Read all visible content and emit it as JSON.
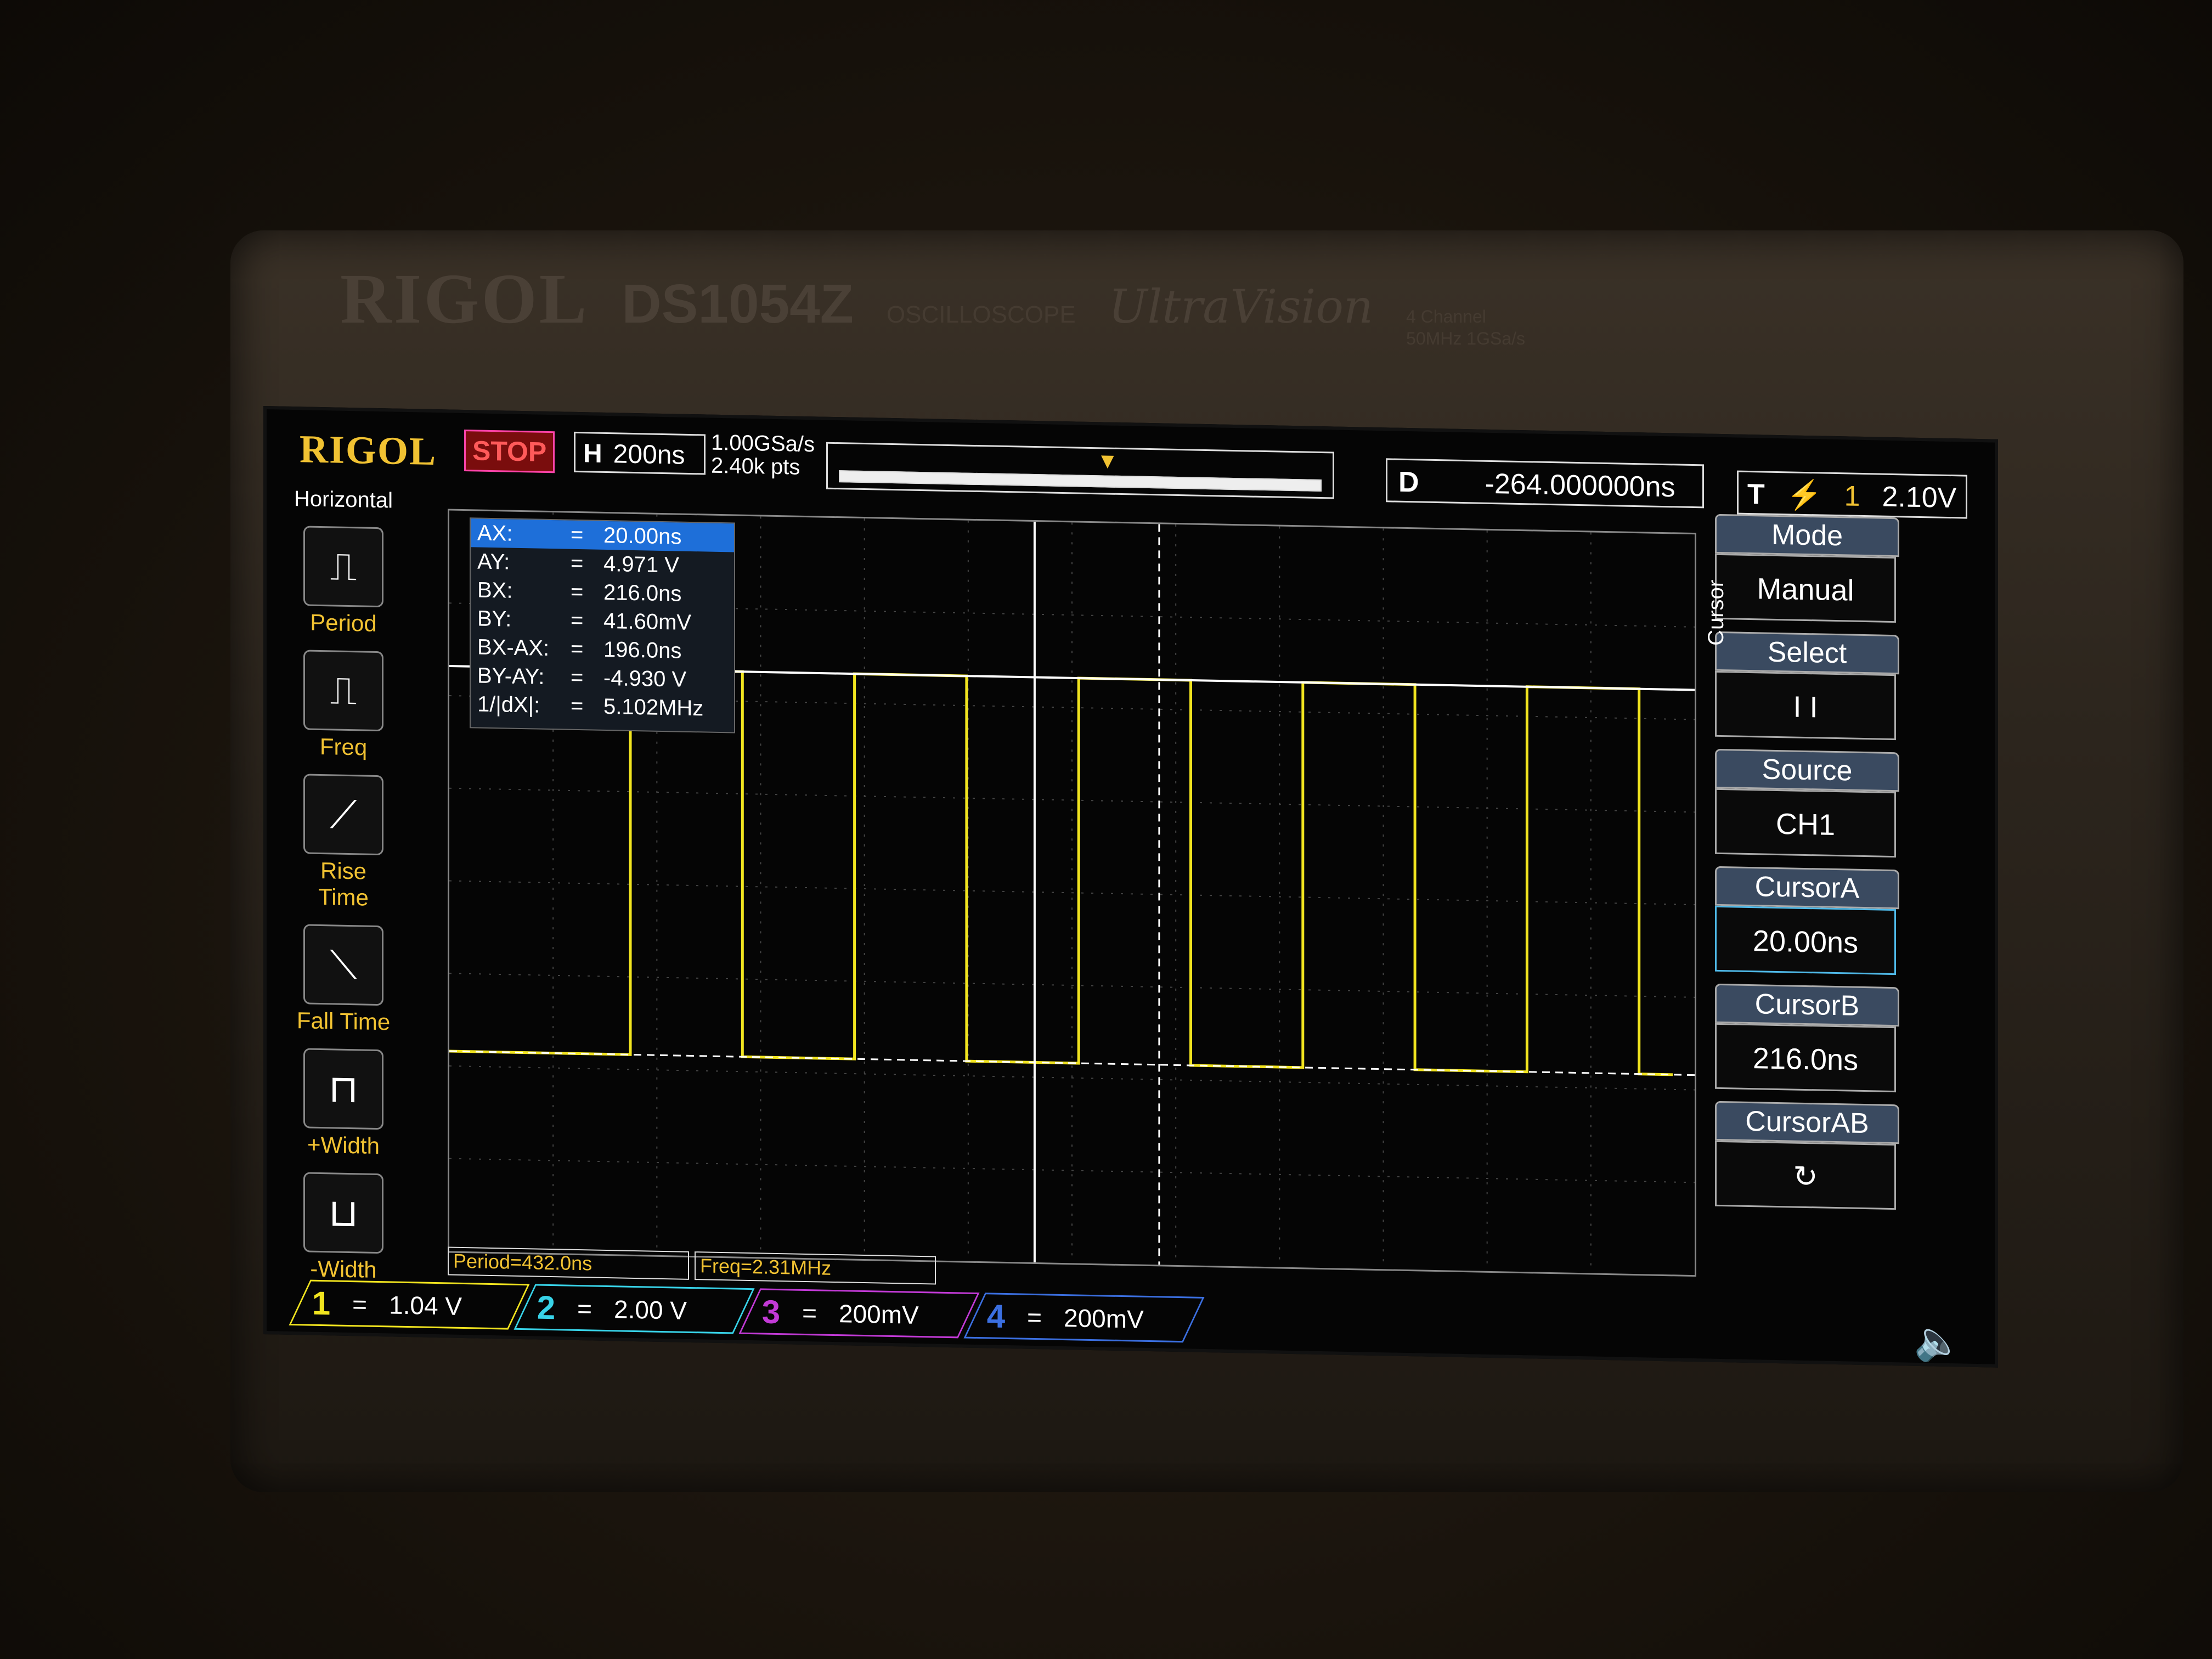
{
  "device": {
    "brand": "RIGOL",
    "model": "DS1054Z",
    "subtitle": "OSCILLOSCOPE",
    "series": "UltraVision",
    "spec_line1": "4 Channel",
    "spec_line2": "50MHz  1GSa/s"
  },
  "header": {
    "logo": "RIGOL",
    "run_state": "STOP",
    "timebase_label": "H",
    "timebase_value": "200ns",
    "sample_rate": "1.00GSa/s",
    "memory_points": "2.40k pts",
    "delay_label": "D",
    "delay_value": "-264.000000ns",
    "trigger_label": "T",
    "trigger_channel": "1",
    "trigger_level": "2.10V"
  },
  "left_menu": {
    "title": "Horizontal",
    "items": [
      {
        "label": "Period",
        "icon": "period-icon"
      },
      {
        "label": "Freq",
        "icon": "freq-icon"
      },
      {
        "label": "Rise Time",
        "icon": "rise-time-icon"
      },
      {
        "label": "Fall Time",
        "icon": "fall-time-icon"
      },
      {
        "label": "+Width",
        "icon": "pos-width-icon"
      },
      {
        "label": "-Width",
        "icon": "neg-width-icon"
      }
    ]
  },
  "cursor_readout": [
    {
      "key": "AX:",
      "value": "20.00ns"
    },
    {
      "key": "AY:",
      "value": "4.971 V"
    },
    {
      "key": "BX:",
      "value": "216.0ns"
    },
    {
      "key": "BY:",
      "value": "41.60mV"
    },
    {
      "key": "BX-AX:",
      "value": "196.0ns"
    },
    {
      "key": "BY-AY:",
      "value": "-4.930 V"
    },
    {
      "key": "1/|dX|:",
      "value": "5.102MHz"
    }
  ],
  "right_menu": {
    "side_label": "Cursor",
    "mode_title": "Mode",
    "mode_value": "Manual",
    "select_title": "Select",
    "select_value": "I  I",
    "source_title": "Source",
    "source_value": "CH1",
    "cursor_a_title": "CursorA",
    "cursor_a_value": "20.00ns",
    "cursor_b_title": "CursorB",
    "cursor_b_value": "216.0ns",
    "cursor_ab_title": "CursorAB"
  },
  "measurements": {
    "period": "Period=432.0ns",
    "freq": "Freq=2.31MHz"
  },
  "channels": [
    {
      "num": "1",
      "coupling": "=",
      "scale": "1.04 V",
      "color": "#f1e41f"
    },
    {
      "num": "2",
      "coupling": "=",
      "scale": "2.00 V",
      "color": "#38d3e8"
    },
    {
      "num": "3",
      "coupling": "=",
      "scale": "200mV",
      "color": "#c23ad6"
    },
    {
      "num": "4",
      "coupling": "=",
      "scale": "200mV",
      "color": "#3b6fe0"
    }
  ],
  "waveform": {
    "channel": "CH1",
    "color": "#f1e41f",
    "high_level_v": 4.971,
    "low_level_v": 0.0416,
    "period_ns": 432.0
  }
}
